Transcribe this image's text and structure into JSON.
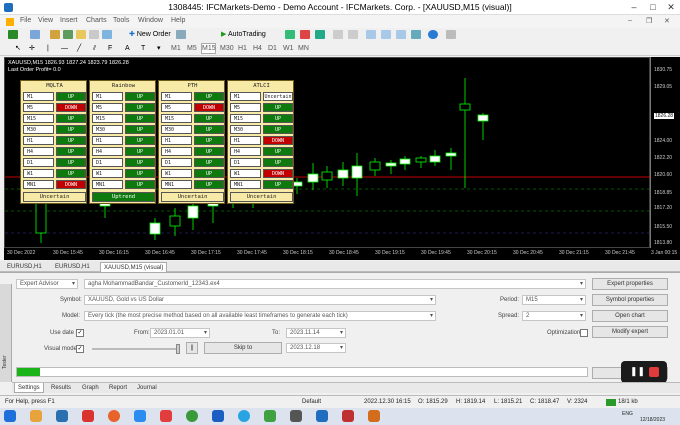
{
  "window": {
    "title": "1308445: IFCMarkets-Demo - Demo Account - IFCMarkets. Corp. - [XAUUSD,M15 (visual)]"
  },
  "menu": [
    "File",
    "View",
    "Insert",
    "Charts",
    "Tools",
    "Window",
    "Help"
  ],
  "toolbar": {
    "new_order": "New Order",
    "autotrading": "AutoTrading",
    "timeframes": [
      "M1",
      "M5",
      "M15",
      "M30",
      "H1",
      "H4",
      "D1",
      "W1",
      "MN"
    ]
  },
  "chart": {
    "symbol_line": "XAUUSD,M15  1826.93 1827.24 1823.79 1826.28",
    "last_order": "Last Order Profit= 0.0",
    "y_labels": [
      "1830.75",
      "1829.05",
      "1826.28",
      "1824.00",
      "1822.20",
      "1820.60",
      "1818.85",
      "1817.20",
      "1815.50",
      "1813.80"
    ],
    "current_price": "1826.28",
    "x_labels": [
      "30 Dec 2022",
      "30 Dec 15:45",
      "30 Dec 16:15",
      "30 Dec 16:45",
      "30 Dec 17:15",
      "30 Dec 17:45",
      "30 Dec 18:15",
      "30 Dec 18:45",
      "30 Dec 19:15",
      "30 Dec 19:45",
      "30 Dec 20:15",
      "30 Dec 20:45",
      "30 Dec 21:15",
      "30 Dec 21:45",
      "3 Jan 00:15"
    ],
    "colors": {
      "bg": "#000000",
      "up": "#00ff00",
      "down": "#ffffff",
      "bid": "#ff0000",
      "grid": "#1a1a1a"
    }
  },
  "panels": [
    {
      "title": "MQLTA",
      "rows": [
        [
          "M1",
          "UP"
        ],
        [
          "M5",
          "DOWN"
        ],
        [
          "M15",
          "UP"
        ],
        [
          "M30",
          "UP"
        ],
        [
          "H1",
          "UP"
        ],
        [
          "H4",
          "UP"
        ],
        [
          "D1",
          "UP"
        ],
        [
          "W1",
          "UP"
        ],
        [
          "MN1",
          "DOWN"
        ]
      ],
      "footer": "Uncertain",
      "footer_state": "neutral"
    },
    {
      "title": "Rainbow",
      "rows": [
        [
          "M1",
          "UP"
        ],
        [
          "M5",
          "UP"
        ],
        [
          "M15",
          "UP"
        ],
        [
          "M30",
          "UP"
        ],
        [
          "H1",
          "UP"
        ],
        [
          "H4",
          "UP"
        ],
        [
          "D1",
          "UP"
        ],
        [
          "W1",
          "UP"
        ],
        [
          "MN1",
          "UP"
        ]
      ],
      "footer": "Uptrend",
      "footer_state": "up"
    },
    {
      "title": "PTH",
      "rows": [
        [
          "M1",
          "UP"
        ],
        [
          "M5",
          "DOWN"
        ],
        [
          "M15",
          "UP"
        ],
        [
          "M30",
          "UP"
        ],
        [
          "H1",
          "UP"
        ],
        [
          "H4",
          "UP"
        ],
        [
          "D1",
          "UP"
        ],
        [
          "W1",
          "UP"
        ],
        [
          "MN1",
          "UP"
        ]
      ],
      "footer": "Uncertain",
      "footer_state": "neutral"
    },
    {
      "title": "ATLCI",
      "rows": [
        [
          "M1",
          "Uncertain"
        ],
        [
          "M5",
          "UP"
        ],
        [
          "M15",
          "UP"
        ],
        [
          "M30",
          "UP"
        ],
        [
          "H1",
          "DOWN"
        ],
        [
          "H4",
          "UP"
        ],
        [
          "D1",
          "UP"
        ],
        [
          "W1",
          "DOWN"
        ],
        [
          "MN1",
          "UP"
        ]
      ],
      "footer": "Uncertain",
      "footer_state": "neutral"
    }
  ],
  "chart_tabs": [
    "EURUSD,H1",
    "EURUSD,H1",
    "XAUUSD,M15 (visual)"
  ],
  "tester": {
    "type": "Expert Advisor",
    "ea_path": "agha MohammadBandar_CustomerId_12343.ex4",
    "symbol_label": "Symbol:",
    "symbol": "XAUUSD, Gold vs US Dollar",
    "model_label": "Model:",
    "model": "Every tick (the most precise method based on all available least timeframes to generate each tick)",
    "use_date_label": "Use date",
    "from_label": "From:",
    "from": "2023.01.01",
    "to_label": "To:",
    "to": "2023.11.14",
    "visual_label": "Visual mode",
    "skip_to": "Skip to",
    "skip_date": "2023.12.18",
    "period_label": "Period:",
    "period": "M15",
    "spread_label": "Spread:",
    "spread": "2",
    "optimization_label": "Optimization",
    "buttons": {
      "expert_props": "Expert properties",
      "symbol_props": "Symbol properties",
      "open_chart": "Open chart",
      "modify_expert": "Modify expert",
      "start": "Start"
    },
    "progress": 0.04,
    "side_label": "Tester"
  },
  "bottom_tabs": [
    "Settings",
    "Results",
    "Graph",
    "Report",
    "Journal"
  ],
  "status": {
    "help": "For Help, press F1",
    "profile": "Default",
    "time": "2022.12.30 16:15",
    "open": "O: 1815.29",
    "high": "H: 1819.14",
    "low": "L: 1815.21",
    "close": "C: 1818.47",
    "volume": "V: 2324",
    "traffic": "18/1 kb"
  },
  "taskbar": {
    "time": "12/18/2023",
    "lang": "ENG"
  }
}
